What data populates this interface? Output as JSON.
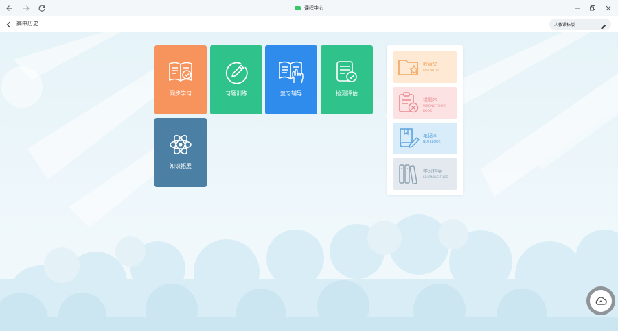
{
  "window": {
    "title": "课程中心",
    "title_dot_color": "#3cc46a"
  },
  "nav": {
    "page_title": "高中历史",
    "edition": "人教课标版"
  },
  "tiles": [
    {
      "label": "同步学习",
      "color": "#f7935d",
      "icon": "book-icon"
    },
    {
      "label": "习题训练",
      "color": "#2fc28b",
      "icon": "pencil-circle-icon"
    },
    {
      "label": "复习辅导",
      "color": "#2f8cec",
      "icon": "book-hand-icon"
    },
    {
      "label": "检测评估",
      "color": "#2fc28b",
      "icon": "checklist-icon"
    },
    {
      "label": "知识拓展",
      "color": "#4b7fa3",
      "icon": "atom-icon"
    }
  ],
  "cards": [
    {
      "title": "收藏夹",
      "sub": "FAVORITES",
      "bg": "#fde9d4",
      "fg": "#f0a560",
      "icon": "folder-star-icon"
    },
    {
      "title": "错题本",
      "sub": "WRONG TOPIC BOOK",
      "bg": "#fde2e3",
      "fg": "#e88b8f",
      "icon": "clipboard-x-icon"
    },
    {
      "title": "笔记本",
      "sub": "NOTEBOOK",
      "bg": "#d9ecfa",
      "fg": "#5aa2dc",
      "icon": "notebook-pen-icon"
    },
    {
      "title": "学习档案",
      "sub": "LEARNING FILES",
      "bg": "#e3e9ee",
      "fg": "#8fa3b3",
      "icon": "binders-icon"
    }
  ]
}
